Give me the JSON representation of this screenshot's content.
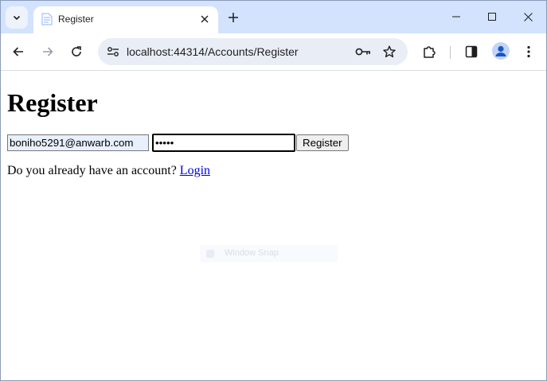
{
  "browser": {
    "tab": {
      "title": "Register"
    },
    "address_bar": {
      "url": "localhost:44314/Accounts/Register"
    }
  },
  "page": {
    "heading": "Register",
    "form": {
      "email_value": "boniho5291@anwarb.com",
      "password_value": "•••••",
      "submit_label": "Register"
    },
    "account_prompt": "Do you already have an account?",
    "login_link": "Login"
  },
  "overlay": {
    "snap_hint": "Window Snap"
  },
  "colors": {
    "tabstrip": "#d3e3fd",
    "omnibox": "#e9eef6",
    "link": "#0000ee",
    "autofill": "#e8f0fe"
  }
}
